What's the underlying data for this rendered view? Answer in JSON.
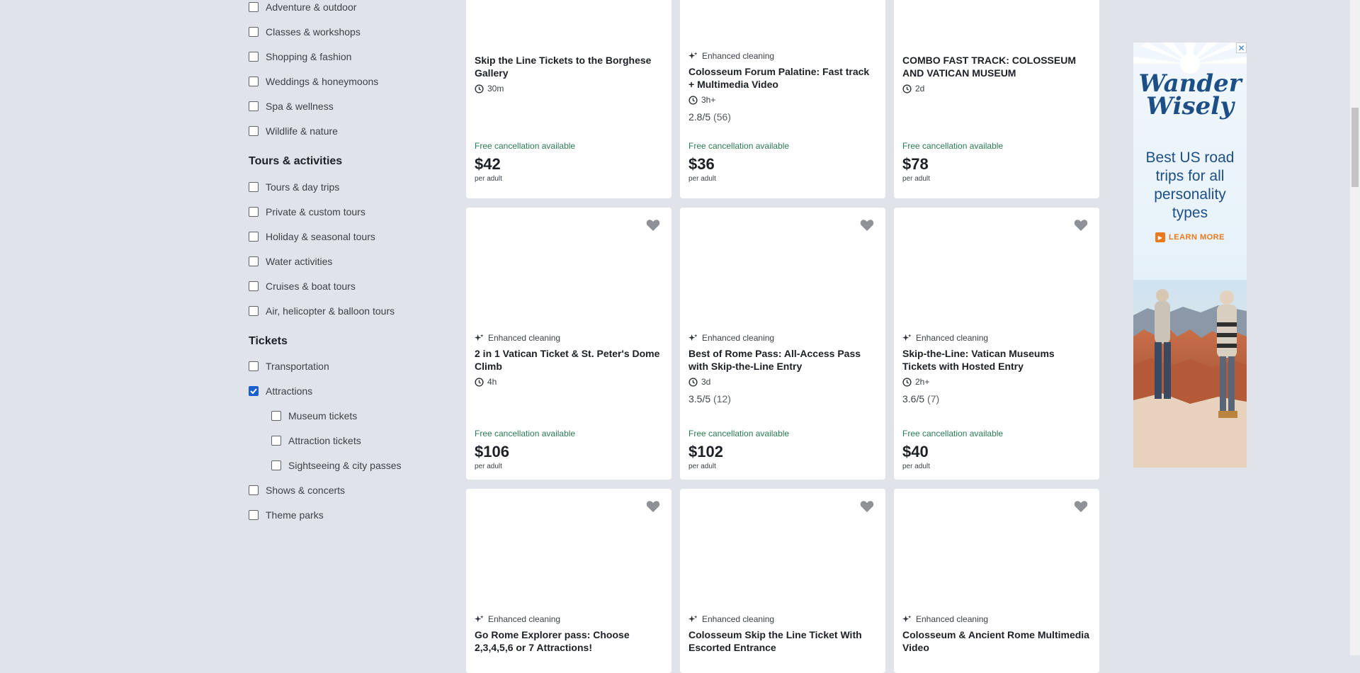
{
  "filters": {
    "top_items": [
      {
        "label": "Adventure & outdoor",
        "checked": false
      },
      {
        "label": "Classes & workshops",
        "checked": false
      },
      {
        "label": "Shopping & fashion",
        "checked": false
      },
      {
        "label": "Weddings & honeymoons",
        "checked": false
      },
      {
        "label": "Spa & wellness",
        "checked": false
      },
      {
        "label": "Wildlife & nature",
        "checked": false
      }
    ],
    "tours_title": "Tours & activities",
    "tours_items": [
      {
        "label": "Tours & day trips",
        "checked": false
      },
      {
        "label": "Private & custom tours",
        "checked": false
      },
      {
        "label": "Holiday & seasonal tours",
        "checked": false
      },
      {
        "label": "Water activities",
        "checked": false
      },
      {
        "label": "Cruises & boat tours",
        "checked": false
      },
      {
        "label": "Air, helicopter & balloon tours",
        "checked": false
      }
    ],
    "tickets_title": "Tickets",
    "tickets_items": [
      {
        "label": "Transportation",
        "checked": false
      },
      {
        "label": "Attractions",
        "checked": true
      },
      {
        "label": "Museum tickets",
        "checked": false
      },
      {
        "label": "Attraction tickets",
        "checked": false
      },
      {
        "label": "Sightseeing & city passes",
        "checked": false
      },
      {
        "label": "Shows & concerts",
        "checked": false
      },
      {
        "label": "Theme parks",
        "checked": false
      }
    ]
  },
  "products": [
    {
      "enhanced": "",
      "title": "Skip the Line Tickets to the Borghese Gallery",
      "duration": "30m",
      "rating": "",
      "rating_count": "",
      "free_cancel": "Free cancellation available",
      "price": "$42",
      "per": "per adult"
    },
    {
      "enhanced": "Enhanced cleaning",
      "title": "Colosseum Forum Palatine: Fast track + Multimedia Video",
      "duration": "3h+",
      "rating": "2.8/5",
      "rating_count": "(56)",
      "free_cancel": "Free cancellation available",
      "price": "$36",
      "per": "per adult"
    },
    {
      "enhanced": "",
      "title": "COMBO FAST TRACK: COLOSSEUM AND VATICAN MUSEUM",
      "duration": "2d",
      "rating": "",
      "rating_count": "",
      "free_cancel": "Free cancellation available",
      "price": "$78",
      "per": "per adult"
    },
    {
      "enhanced": "Enhanced cleaning",
      "title": "2 in 1 Vatican Ticket & St. Peter's Dome Climb",
      "duration": "4h",
      "rating": "",
      "rating_count": "",
      "free_cancel": "Free cancellation available",
      "price": "$106",
      "per": "per adult"
    },
    {
      "enhanced": "Enhanced cleaning",
      "title": "Best of Rome Pass: All-Access Pass with Skip-the-Line Entry",
      "duration": "3d",
      "rating": "3.5/5",
      "rating_count": "(12)",
      "free_cancel": "Free cancellation available",
      "price": "$102",
      "per": "per adult"
    },
    {
      "enhanced": "Enhanced cleaning",
      "title": "Skip-the-Line: Vatican Museums Tickets with Hosted Entry",
      "duration": "2h+",
      "rating": "3.6/5",
      "rating_count": "(7)",
      "free_cancel": "Free cancellation available",
      "price": "$40",
      "per": "per adult"
    },
    {
      "enhanced": "Enhanced cleaning",
      "title": "Go Rome Explorer pass: Choose 2,3,4,5,6 or 7 Attractions!",
      "duration": "",
      "rating": "",
      "rating_count": "",
      "free_cancel": "",
      "price": "",
      "per": ""
    },
    {
      "enhanced": "Enhanced cleaning",
      "title": "Colosseum Skip the Line Ticket With Escorted Entrance",
      "duration": "",
      "rating": "",
      "rating_count": "",
      "free_cancel": "",
      "price": "",
      "per": ""
    },
    {
      "enhanced": "Enhanced cleaning",
      "title": "Colosseum & Ancient Rome Multimedia Video",
      "duration": "",
      "rating": "",
      "rating_count": "",
      "free_cancel": "",
      "price": "",
      "per": ""
    }
  ],
  "ad": {
    "close": "✕",
    "logo_line1": "Wander",
    "logo_line2": "Wisely",
    "text": "Best US road trips for all personality types",
    "cta": "LEARN MORE"
  },
  "colors": {
    "background": "#e0e4ea",
    "checkbox_checked": "#1a5fd0",
    "free_cancel_green": "#2a7a53",
    "ad_blue": "#1d4f86",
    "ad_orange": "#e8791d"
  },
  "icons": {
    "favorite": "heart-icon",
    "enhanced": "sparkle-icon",
    "duration": "clock-icon",
    "check": "checkmark-icon"
  }
}
